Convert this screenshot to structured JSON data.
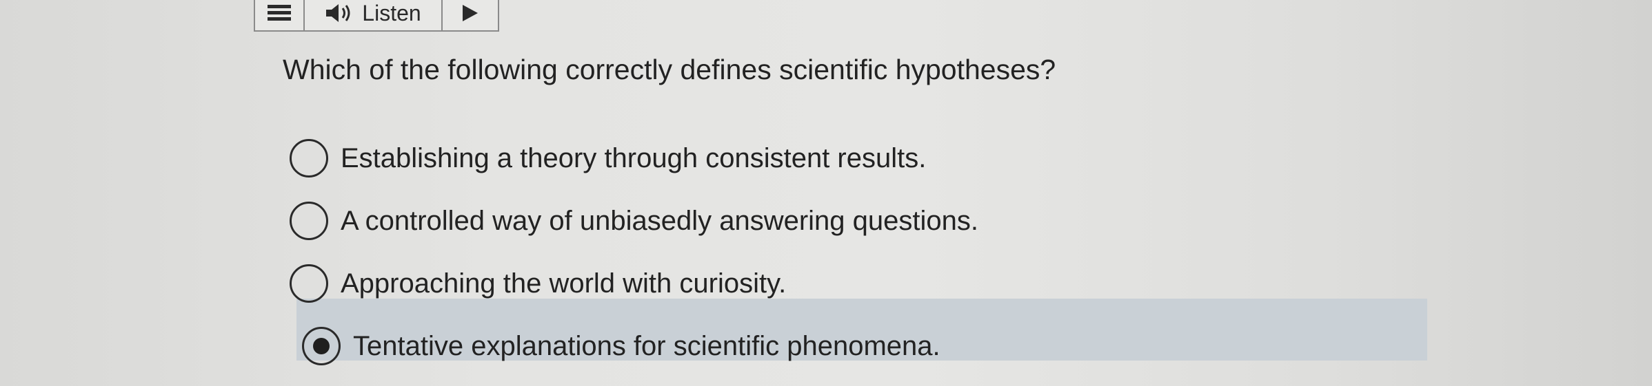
{
  "toolbar": {
    "menu_icon": "menu-lines-icon",
    "listen_icon": "speaker-icon",
    "listen_label": "Listen",
    "play_icon": "play-triangle-icon"
  },
  "question": {
    "text": "Which of the following correctly defines scientific hypotheses?"
  },
  "options": [
    {
      "label": "Establishing a theory through consistent results.",
      "selected": false
    },
    {
      "label": "A controlled way of unbiasedly answering questions.",
      "selected": false
    },
    {
      "label": "Approaching the world with curiosity.",
      "selected": false
    },
    {
      "label": "Tentative explanations for scientific phenomena.",
      "selected": true
    }
  ],
  "colors": {
    "selected_highlight": "#c9d0d6",
    "text": "#222222"
  }
}
